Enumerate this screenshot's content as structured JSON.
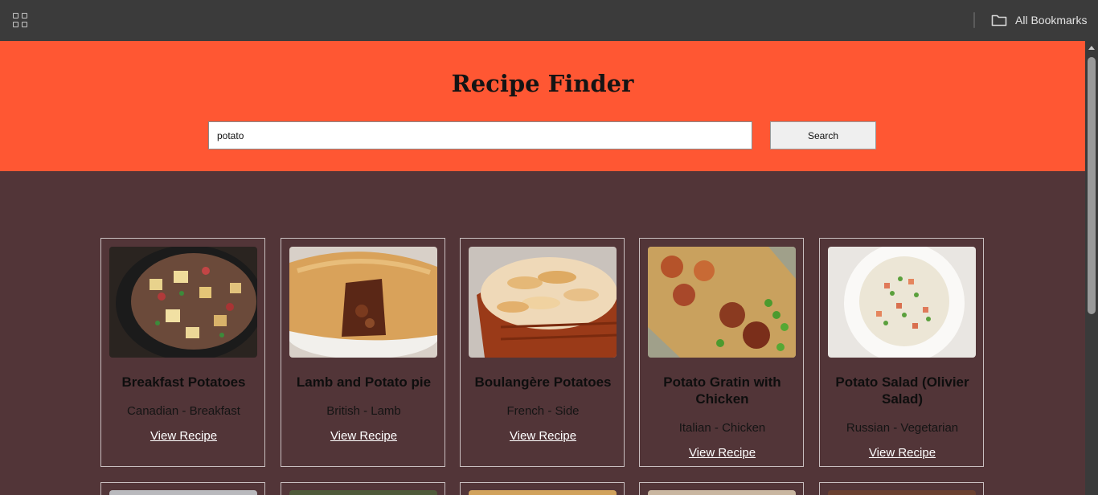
{
  "browser": {
    "apps_icon": "apps-grid-icon",
    "bookmarks_icon": "folder-icon",
    "bookmarks_label": "All Bookmarks"
  },
  "header": {
    "title": "Recipe Finder",
    "search_value": "potato",
    "search_button": "Search",
    "background_color": "#ff5733"
  },
  "recipes": [
    {
      "title": "Breakfast Potatoes",
      "meta": "Canadian - Breakfast",
      "link": "View Recipe",
      "image": "breakfast-potatoes-photo"
    },
    {
      "title": "Lamb and Potato pie",
      "meta": "British - Lamb",
      "link": "View Recipe",
      "image": "lamb-potato-pie-photo"
    },
    {
      "title": "Boulangère Potatoes",
      "meta": "French - Side",
      "link": "View Recipe",
      "image": "boulangere-potatoes-photo"
    },
    {
      "title": "Potato Gratin with Chicken",
      "meta": "Italian - Chicken",
      "link": "View Recipe",
      "image": "potato-gratin-chicken-photo"
    },
    {
      "title": "Potato Salad (Olivier Salad)",
      "meta": "Russian - Vegetarian",
      "link": "View Recipe",
      "image": "olivier-salad-photo"
    }
  ]
}
